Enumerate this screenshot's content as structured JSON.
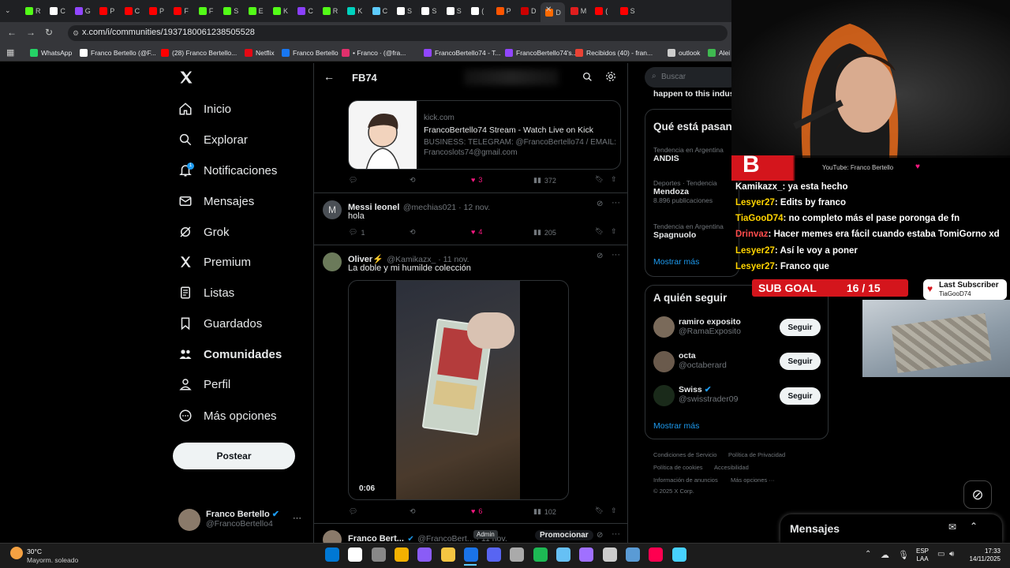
{
  "browser": {
    "tabs": [
      "R",
      "C",
      "G",
      "P",
      "C",
      "P",
      "F",
      "F",
      "S",
      "E",
      "K",
      "C",
      "R",
      "K",
      "C",
      "S",
      "S",
      "S",
      "(",
      "P",
      "D",
      "D",
      "M",
      "(",
      "S"
    ],
    "tab_colors": [
      "#53fc18",
      "#ffffff",
      "#9146ff",
      "#ff0000",
      "#ff0000",
      "#ff0000",
      "#ff0000",
      "#53fc18",
      "#53fc18",
      "#53fc18",
      "#53fc18",
      "#8a3ffc",
      "#53fc18",
      "#00d2be",
      "#5dcbff",
      "#ffffff",
      "#ffffff",
      "#ffffff",
      "#ffffff",
      "#ff5500",
      "#cc0000",
      "#ff6a00",
      "#e01e1e",
      "#ff0000",
      "#ff0000"
    ],
    "url": "x.com/i/communities/1937180061238505528",
    "bookmarks": [
      "WhatsApp",
      "Franco Bertello (@F...",
      "(28) Franco Bertello...",
      "Netflix",
      "Franco Bertello",
      "• Franco ∙ (@fra...",
      "FrancoBertello74 - T...",
      "FrancoBertello74's...",
      "Recibidos (40) - fran...",
      "outlook",
      "Alei"
    ],
    "bookmark_colors": [
      "#25d366",
      "#ffffff",
      "#ff0000",
      "#e50914",
      "#1877f2",
      "#e1306c",
      "#9146ff",
      "#9146ff",
      "#ea4335",
      "#cccccc",
      "#3fb950"
    ]
  },
  "nav": {
    "items": [
      "Inicio",
      "Explorar",
      "Notificaciones",
      "Mensajes",
      "Grok",
      "Premium",
      "Listas",
      "Guardados",
      "Comunidades",
      "Perfil",
      "Más opciones"
    ],
    "notif_badge": "1",
    "post_button": "Postear",
    "profile": {
      "name": "Franco Bertello",
      "handle": "@FrancoBertello4",
      "more": "···"
    }
  },
  "header": {
    "title": "FB74",
    "back": "←"
  },
  "link_card": {
    "domain": "kick.com",
    "title": "FrancoBertello74 Stream - Watch Live on Kick",
    "desc": "BUSINESS: TELEGRAM: @FrancoBertello74 / EMAIL: Francoslots74@gmail.com",
    "stats": {
      "likes": "3",
      "views": "372"
    }
  },
  "posts": [
    {
      "name": "Messi leonel",
      "handle": "@mechias021 · 12 nov.",
      "text": "hola",
      "avatar": "M",
      "replies": "1",
      "likes": "4",
      "views": "205"
    },
    {
      "name": "Oliver⚡",
      "handle": "@Kamikazx_ · 11 nov.",
      "text": "La doble y mi humilde colección",
      "video_time": "0:06",
      "likes": "6",
      "views": "102"
    },
    {
      "name": "Franco Bert...",
      "handle": "@FrancoBert... · 11 nov.",
      "badge": "Admin",
      "promo": "Promocionar"
    }
  ],
  "search": {
    "placeholder": "Buscar",
    "cutoff": "happen to this indus"
  },
  "trends": {
    "title": "Qué está pasan",
    "items": [
      {
        "cat": "Tendencia en Argentina",
        "name": "ANDIS",
        "count": ""
      },
      {
        "cat": "Deportes · Tendencia",
        "name": "Mendoza",
        "count": "8.896 publicaciones"
      },
      {
        "cat": "Tendencia en Argentina",
        "name": "Spagnuolo",
        "count": ""
      }
    ],
    "more": "Mostrar más"
  },
  "follow": {
    "title": "A quién seguir",
    "items": [
      {
        "name": "ramiro exposito",
        "handle": "@RamaExposito",
        "btn": "Seguir"
      },
      {
        "name": "octa",
        "handle": "@octaberard",
        "btn": "Seguir"
      },
      {
        "name": "Swiss",
        "handle": "@swisstrader09",
        "btn": "Seguir"
      }
    ],
    "more": "Mostrar más"
  },
  "footer": {
    "links": [
      "Condiciones de Servicio",
      "Política de Privacidad",
      "Política de cookies",
      "Accesibilidad",
      "Información de anuncios",
      "Más opciones ···"
    ],
    "copyright": "© 2025 X Corp."
  },
  "messages_dock": {
    "title": "Mensajes"
  },
  "overlay": {
    "yt_label": "YouTube: Franco Bertello",
    "chat": [
      {
        "user": "Kamikazx_",
        "msg": ": ya esta hecho",
        "color": "#ffffff"
      },
      {
        "user": "Lesyer27",
        "msg": ": Edits by franco",
        "color": "#ffd400"
      },
      {
        "user": "TiaGooD74",
        "msg": ": no completo más el pase poronga de fn",
        "color": "#ffd400"
      },
      {
        "user": "Drinvaz",
        "msg": ": Hacer memes era fácil cuando estaba TomiGorno xd",
        "color": "#ff4d4d"
      },
      {
        "user": "Lesyer27",
        "msg": ": Así le voy a poner",
        "color": "#ffd400"
      },
      {
        "user": "Lesyer27",
        "msg": ": Franco que",
        "color": "#ffd400"
      }
    ],
    "sub_goal_label": "SUB GOAL",
    "sub_goal_value": "16 / 15",
    "last_sub_label": "Last Subscriber",
    "last_sub_name": "TiaGooD74"
  },
  "taskbar": {
    "weather_temp": "30°C",
    "weather_desc": "Mayorm. soleado",
    "lang": "ESP",
    "lang2": "LAA",
    "time": "17:33",
    "date": "14/11/2025",
    "app_colors": [
      "#0078d4",
      "#ffffff",
      "#888888",
      "#f3b100",
      "#8a5cf6",
      "#f4c542",
      "#1a73e8",
      "#5865f2",
      "#aaaaaa",
      "#1db954",
      "#66c0f4",
      "#a070ff",
      "#cccccc",
      "#5a9bd5",
      "#ff0050",
      "#47d2ff"
    ]
  },
  "colors": {
    "like": "#f91880",
    "accent": "#1d9bf0",
    "sub_goal": "#d4151c"
  }
}
